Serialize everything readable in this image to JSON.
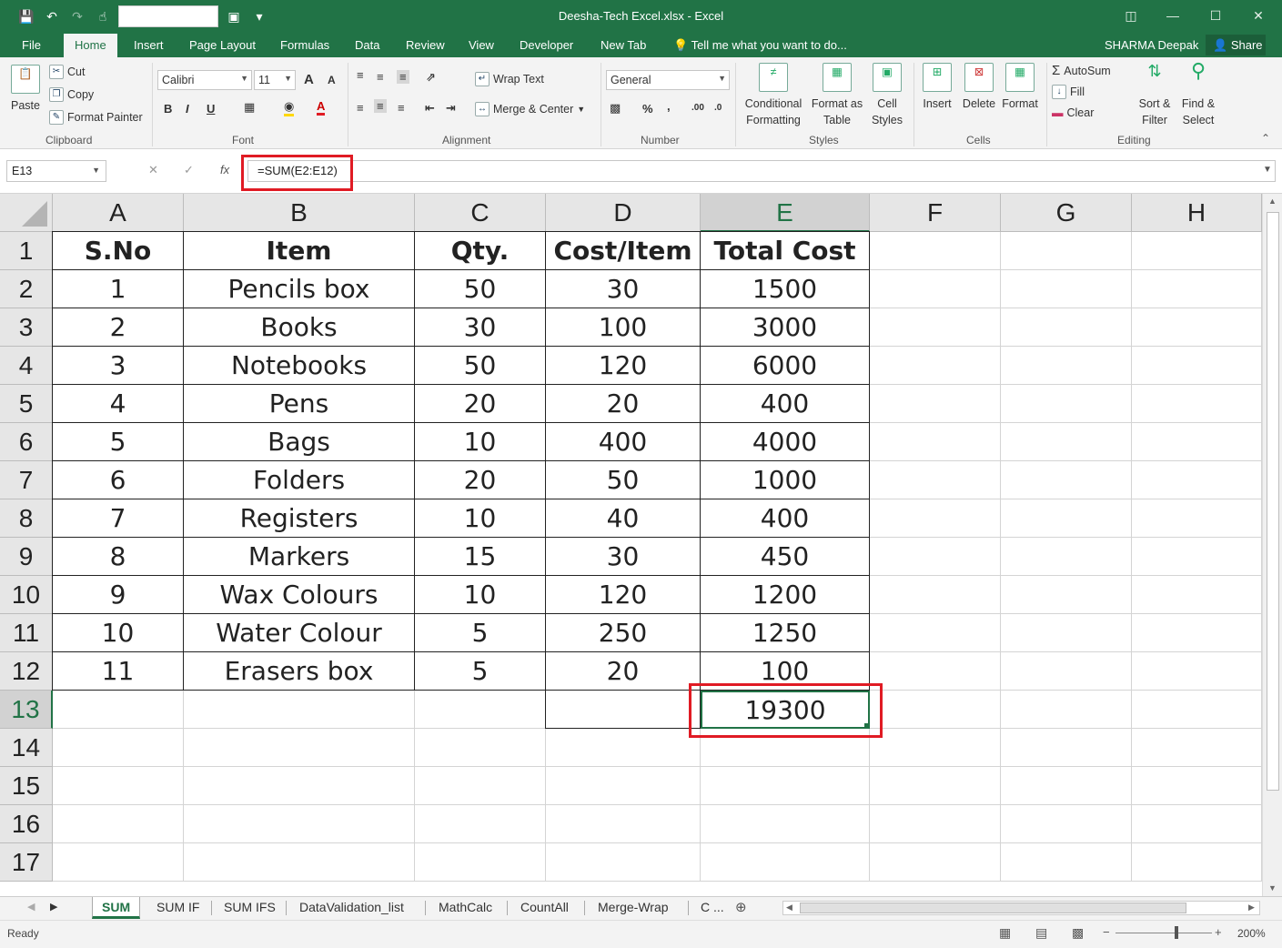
{
  "window": {
    "title": "Deesha-Tech Excel.xlsx - Excel",
    "user": "SHARMA Deepak",
    "share": "Share"
  },
  "ribbon_tabs": [
    "File",
    "Home",
    "Insert",
    "Page Layout",
    "Formulas",
    "Data",
    "Review",
    "View",
    "Developer",
    "New Tab"
  ],
  "active_tab": "Home",
  "tell_me": "Tell me what you want to do...",
  "clipboard": {
    "paste": "Paste",
    "cut": "Cut",
    "copy": "Copy",
    "painter": "Format Painter",
    "label": "Clipboard"
  },
  "font": {
    "name": "Calibri",
    "size": "11",
    "bold": "B",
    "italic": "I",
    "underline": "U",
    "grow": "A",
    "shrink": "A",
    "label": "Font"
  },
  "alignment": {
    "wrap": "Wrap Text",
    "merge": "Merge & Center",
    "label": "Alignment"
  },
  "number": {
    "format": "General",
    "percent": "%",
    "comma": ",",
    "label": "Number"
  },
  "styles": {
    "conditional": [
      "Conditional",
      "Formatting"
    ],
    "table": [
      "Format as",
      "Table"
    ],
    "cell": [
      "Cell",
      "Styles"
    ],
    "label": "Styles"
  },
  "cells": {
    "insert": "Insert",
    "delete": "Delete",
    "format": "Format",
    "label": "Cells"
  },
  "editing": {
    "autosum": "AutoSum",
    "fill": "Fill",
    "clear": "Clear",
    "sort": [
      "Sort &",
      "Filter"
    ],
    "find": [
      "Find &",
      "Select"
    ],
    "label": "Editing"
  },
  "formula_bar": {
    "name_box": "E13",
    "formula": "=SUM(E2:E12)"
  },
  "columns": [
    "A",
    "B",
    "C",
    "D",
    "E",
    "F",
    "G",
    "H"
  ],
  "selected_column": "E",
  "selected_row": 13,
  "rows": [
    1,
    2,
    3,
    4,
    5,
    6,
    7,
    8,
    9,
    10,
    11,
    12,
    13,
    14,
    15,
    16,
    17
  ],
  "table": {
    "headers": [
      "S.No",
      "Item",
      "Qty.",
      "Cost/Item",
      "Total Cost"
    ],
    "data": [
      [
        "1",
        "Pencils box",
        "50",
        "30",
        "1500"
      ],
      [
        "2",
        "Books",
        "30",
        "100",
        "3000"
      ],
      [
        "3",
        "Notebooks",
        "50",
        "120",
        "6000"
      ],
      [
        "4",
        "Pens",
        "20",
        "20",
        "400"
      ],
      [
        "5",
        "Bags",
        "10",
        "400",
        "4000"
      ],
      [
        "6",
        "Folders",
        "20",
        "50",
        "1000"
      ],
      [
        "7",
        "Registers",
        "10",
        "40",
        "400"
      ],
      [
        "8",
        "Markers",
        "15",
        "30",
        "450"
      ],
      [
        "9",
        "Wax Colours",
        "10",
        "120",
        "1200"
      ],
      [
        "10",
        "Water Colour",
        "5",
        "250",
        "1250"
      ],
      [
        "11",
        "Erasers box",
        "5",
        "20",
        "100"
      ]
    ],
    "total": "19300"
  },
  "sheets": [
    "SUM",
    "SUM IF",
    "SUM IFS",
    "DataValidation_list",
    "MathCalc",
    "CountAll",
    "Merge-Wrap",
    "C ..."
  ],
  "active_sheet": "SUM",
  "status": {
    "ready": "Ready",
    "zoom": "200%"
  },
  "colors": {
    "excel_green": "#217346",
    "highlight_red": "#e01b24"
  }
}
